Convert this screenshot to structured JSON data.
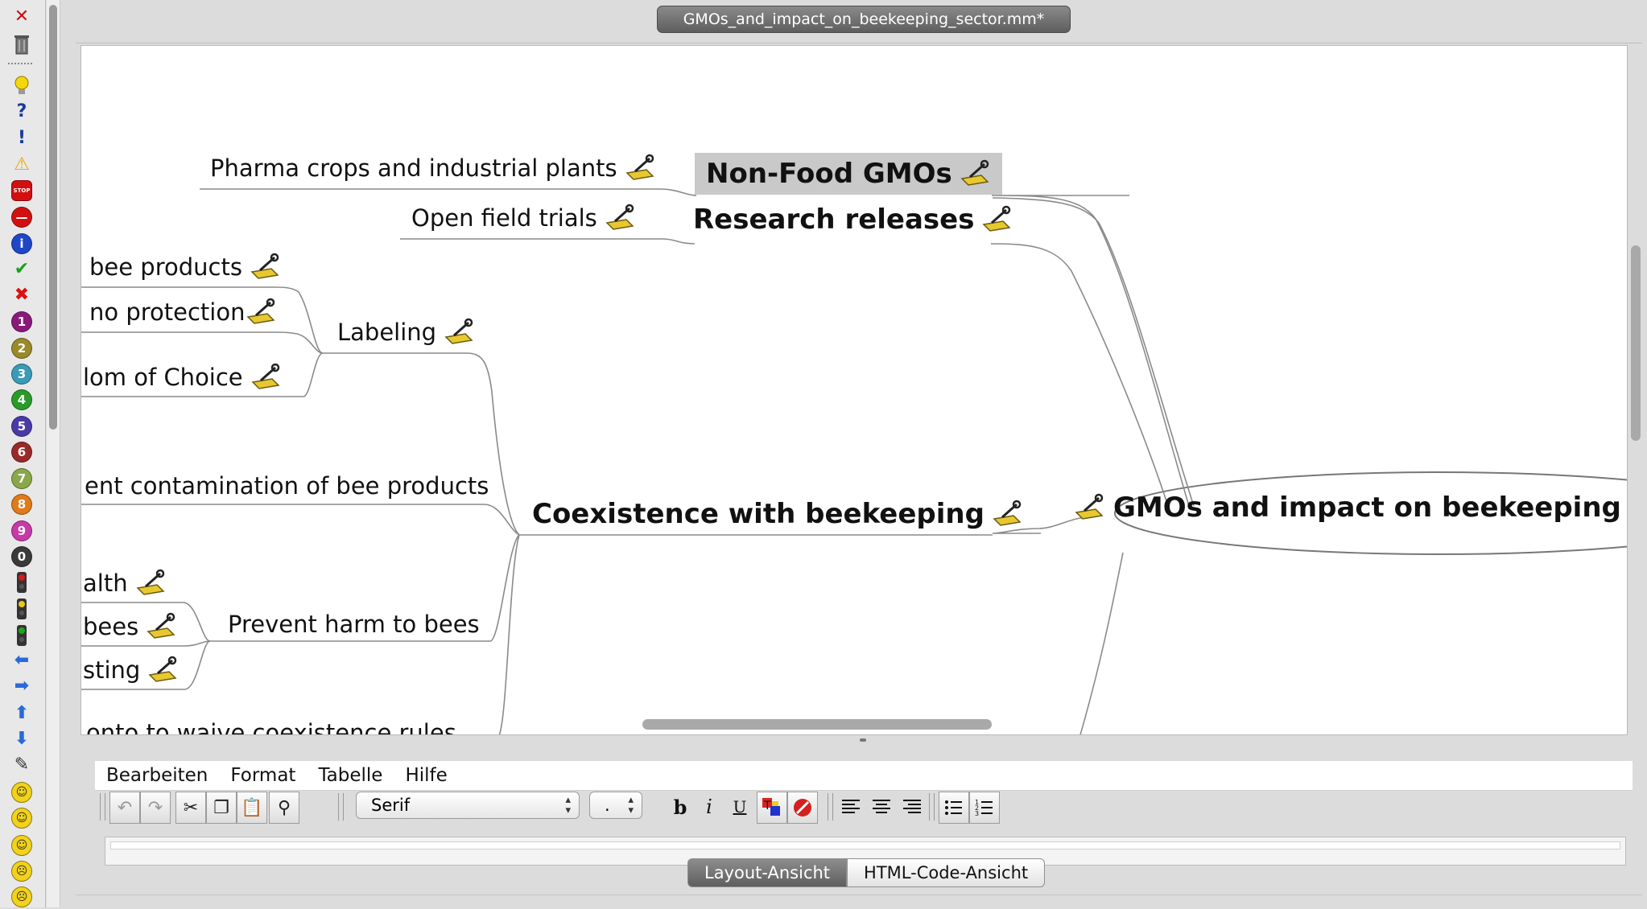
{
  "window": {
    "title": "GMOs_and_impact_on_beekeeping_sector.mm*"
  },
  "icon_toolbar": {
    "items": [
      {
        "name": "remove-icon",
        "glyph": "✕",
        "color": "#cc1111"
      },
      {
        "name": "trash-icon",
        "glyph": "",
        "color": "#555555"
      },
      {
        "name": "idea-icon",
        "glyph": "",
        "color": "#f5d60a"
      },
      {
        "name": "question-icon",
        "glyph": "?",
        "color": "#1a3a9a"
      },
      {
        "name": "important-icon",
        "glyph": "!",
        "color": "#1a3a9a"
      },
      {
        "name": "warning-icon",
        "glyph": "⚠",
        "color": "#e6a800"
      },
      {
        "name": "stop-sign-icon",
        "glyph": "STOP",
        "color": "#d21010"
      },
      {
        "name": "no-entry-icon",
        "glyph": "—",
        "color": "#d21010"
      },
      {
        "name": "info-icon",
        "glyph": "i",
        "color": "#1f46c8"
      },
      {
        "name": "checkmark-icon",
        "glyph": "✔",
        "color": "#1aa01a"
      },
      {
        "name": "cross-icon",
        "glyph": "✖",
        "color": "#dd1111"
      },
      {
        "name": "priority-1-icon",
        "glyph": "1",
        "color": "#8a1a7a"
      },
      {
        "name": "priority-2-icon",
        "glyph": "2",
        "color": "#9a8a2a"
      },
      {
        "name": "priority-3-icon",
        "glyph": "3",
        "color": "#3a9ab8"
      },
      {
        "name": "priority-4-icon",
        "glyph": "4",
        "color": "#2a9a2a"
      },
      {
        "name": "priority-5-icon",
        "glyph": "5",
        "color": "#4a3aa8"
      },
      {
        "name": "priority-6-icon",
        "glyph": "6",
        "color": "#9a2a2a"
      },
      {
        "name": "priority-7-icon",
        "glyph": "7",
        "color": "#8aa84a"
      },
      {
        "name": "priority-8-icon",
        "glyph": "8",
        "color": "#e07a1a"
      },
      {
        "name": "priority-9-icon",
        "glyph": "9",
        "color": "#c83aa8"
      },
      {
        "name": "priority-0-icon",
        "glyph": "0",
        "color": "#3a3a3a"
      },
      {
        "name": "traffic-light-red-icon",
        "glyph": "",
        "color": "#d81a1a"
      },
      {
        "name": "traffic-light-yellow-icon",
        "glyph": "",
        "color": "#e8c81a"
      },
      {
        "name": "traffic-light-green-icon",
        "glyph": "",
        "color": "#1aa81a"
      },
      {
        "name": "arrow-left-icon",
        "glyph": "⬅",
        "color": "#2a6ad8"
      },
      {
        "name": "arrow-right-icon",
        "glyph": "➡",
        "color": "#2a6ad8"
      },
      {
        "name": "arrow-up-icon",
        "glyph": "⬆",
        "color": "#2a6ad8"
      },
      {
        "name": "arrow-down-icon",
        "glyph": "⬇",
        "color": "#2a6ad8"
      },
      {
        "name": "pencil-icon",
        "glyph": "✎",
        "color": "#333333"
      },
      {
        "name": "smiley-happy-icon",
        "glyph": "☺",
        "color": "#f2d21a"
      },
      {
        "name": "smiley-neutral-icon",
        "glyph": "☺",
        "color": "#f2d21a"
      },
      {
        "name": "smiley-surprised-icon",
        "glyph": "☺",
        "color": "#f2d21a"
      },
      {
        "name": "smiley-angry-icon",
        "glyph": "☹",
        "color": "#f2d21a"
      },
      {
        "name": "smiley-sad-icon",
        "glyph": "☹",
        "color": "#f2d21a"
      }
    ]
  },
  "mindmap": {
    "root": "GMOs and impact on beekeeping sec",
    "branches": {
      "non_food": "Non-Food GMOs",
      "research": "Research releases",
      "coexistence": "Coexistence with beekeeping"
    },
    "nodes": {
      "pharma": "Pharma crops and industrial plants",
      "open_field": "Open field trials",
      "bee_products": "bee products",
      "no_protection": "no protection",
      "freedom": "lom of Choice",
      "labeling": "Labeling",
      "contamination": "ent contamination of bee products",
      "health": "alth",
      "bees": "bees",
      "testing": "sting",
      "prevent_harm": "Prevent harm to bees",
      "cut_off": "onto to waive coexistence rules"
    }
  },
  "editor": {
    "menu": [
      "Bearbeiten",
      "Format",
      "Tabelle",
      "Hilfe"
    ],
    "font_family_value": "Serif",
    "font_size_value": ".",
    "tabs": {
      "layout": "Layout-Ansicht",
      "html": "HTML-Code-Ansicht"
    },
    "format_labels": {
      "bold": "b",
      "italic": "i",
      "underline": "U"
    }
  }
}
